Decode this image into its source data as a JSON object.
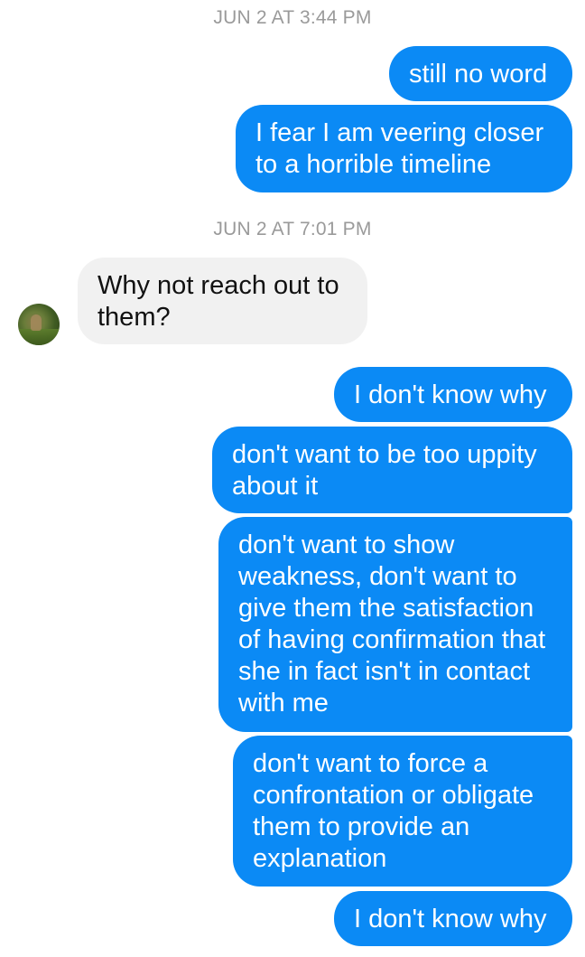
{
  "conversation": {
    "timestamps": [
      "JUN 2 AT 3:44 PM",
      "JUN 2 AT 7:01 PM"
    ],
    "messages": [
      {
        "text": "still no word",
        "direction": "outgoing"
      },
      {
        "text": "I fear I am veering closer to a horrible timeline",
        "direction": "outgoing"
      },
      {
        "text": "Why not reach out to them?",
        "direction": "incoming"
      },
      {
        "text": "I don't know why",
        "direction": "outgoing"
      },
      {
        "text": "don't want to be too uppity about it",
        "direction": "outgoing"
      },
      {
        "text": "don't want to show weakness, don't want to give them the satisfaction of having confirmation that she in fact isn't in contact with me",
        "direction": "outgoing"
      },
      {
        "text": "don't want to force a confrontation or obligate them to provide an explanation",
        "direction": "outgoing"
      },
      {
        "text": "I don't know why",
        "direction": "outgoing"
      }
    ]
  },
  "colors": {
    "outgoing_bubble": "#0b8af5",
    "incoming_bubble": "#f1f1f1",
    "timestamp_text": "#9a9a9a"
  },
  "icons": {
    "contact_avatar": "avatar-photo"
  }
}
